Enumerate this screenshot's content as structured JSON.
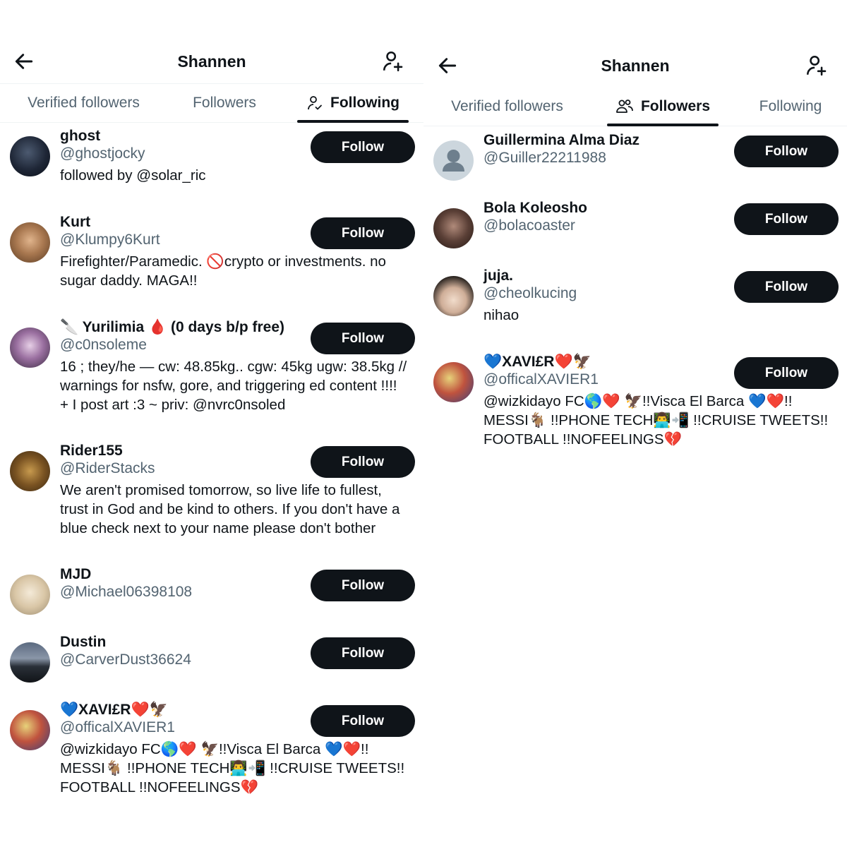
{
  "left": {
    "title": "Shannen",
    "tabs": [
      "Verified followers",
      "Followers",
      "Following"
    ],
    "active_tab": "Following",
    "users": [
      {
        "name": "ghost",
        "handle": "@ghostjocky",
        "bio": "followed by @solar_ric",
        "button": "Follow"
      },
      {
        "name": "Kurt",
        "handle": "@Klumpy6Kurt",
        "bio": "Firefighter/Paramedic. 🚫crypto or investments. no sugar daddy. MAGA!!",
        "button": "Follow"
      },
      {
        "name": "🔪 Yurilimia 🩸 (0 days b/p free)",
        "handle": "@c0nsoleme",
        "bio": "16 ; they/he — cw: 48.85kg.. cgw: 45kg ugw: 38.5kg // warnings for nsfw, gore, and triggering ed content !!!! + I post art :3 ~ priv: @nvrc0nsoled",
        "button": "Follow"
      },
      {
        "name": "Rider155",
        "handle": "@RiderStacks",
        "bio": "We aren't promised tomorrow, so live life to fullest, trust in God and be kind to others. If you don't have a blue check next to your name please don't bother",
        "button": "Follow"
      },
      {
        "name": "MJD",
        "handle": "@Michael06398108",
        "bio": "",
        "button": "Follow"
      },
      {
        "name": "Dustin",
        "handle": "@CarverDust36624",
        "bio": "",
        "button": "Follow"
      },
      {
        "name": "💙XAVI£R❤️🦅",
        "handle": "@officalXAVIER1",
        "bio": "@wizkidayo FC🌎❤️ 🦅!!Visca El Barca 💙❤️!! MESSI🐐 !!PHONE TECH👨‍💻📲 !!CRUISE TWEETS!! FOOTBALL !!NOFEELINGS💔",
        "button": "Follow"
      }
    ]
  },
  "right": {
    "title": "Shannen",
    "tabs": [
      "Verified followers",
      "Followers",
      "Following"
    ],
    "active_tab": "Followers",
    "users": [
      {
        "name": "Guillermina Alma Diaz",
        "handle": "@Guiller22211988",
        "bio": "",
        "button": "Follow"
      },
      {
        "name": "Bola Koleosho",
        "handle": "@bolacoaster",
        "bio": "",
        "button": "Follow"
      },
      {
        "name": "juja.",
        "handle": "@cheolkucing",
        "bio": "nihao",
        "button": "Follow"
      },
      {
        "name": "💙XAVI£R❤️🦅",
        "handle": "@officalXAVIER1",
        "bio": "@wizkidayo FC🌎❤️ 🦅!!Visca El Barca 💙❤️!! MESSI🐐 !!PHONE TECH👨‍💻📲 !!CRUISE TWEETS!! FOOTBALL !!NOFEELINGS💔",
        "button": "Follow"
      }
    ]
  },
  "icons": {
    "back": "arrow-left-icon",
    "add_user": "person-plus-icon",
    "following_tab": "person-check-icon",
    "followers_tab": "people-icon"
  }
}
